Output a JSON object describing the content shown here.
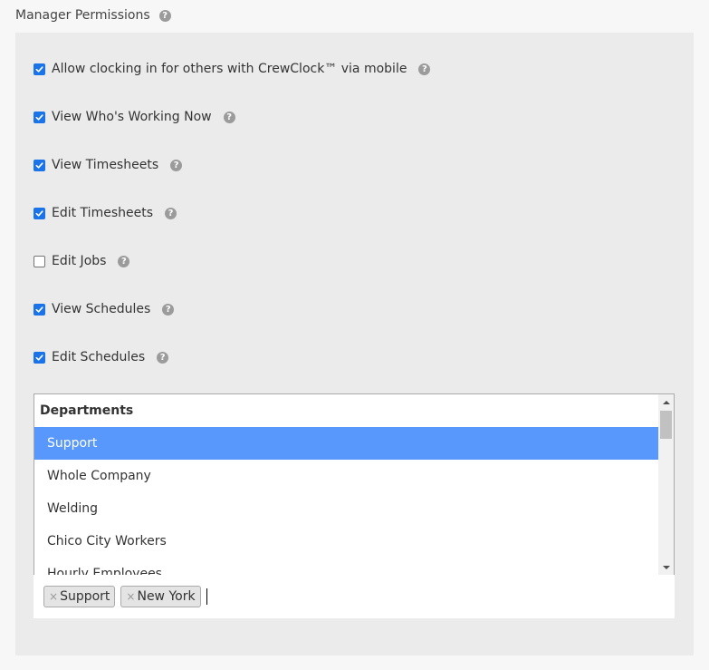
{
  "section": {
    "title": "Manager Permissions"
  },
  "permissions": [
    {
      "label": "Allow clocking in for others with CrewClock™ via mobile",
      "checked": true
    },
    {
      "label": "View Who's Working Now",
      "checked": true
    },
    {
      "label": "View Timesheets",
      "checked": true
    },
    {
      "label": "Edit Timesheets",
      "checked": true
    },
    {
      "label": "Edit Jobs",
      "checked": false
    },
    {
      "label": "View Schedules",
      "checked": true
    },
    {
      "label": "Edit Schedules",
      "checked": true
    }
  ],
  "departments": {
    "group_label": "Departments",
    "options": [
      {
        "label": "Support",
        "highlighted": true
      },
      {
        "label": "Whole Company",
        "highlighted": false
      },
      {
        "label": "Welding",
        "highlighted": false
      },
      {
        "label": "Chico City Workers",
        "highlighted": false
      },
      {
        "label": "Hourly Employees",
        "highlighted": false
      }
    ],
    "selected_tags": [
      {
        "label": "Support",
        "remove": "×"
      },
      {
        "label": "New York",
        "remove": "×"
      }
    ]
  },
  "icons": {
    "help": "question-circle-icon",
    "checkbox_checked": "check-icon",
    "tag_remove": "close-icon"
  },
  "colors": {
    "highlight": "#5897fb",
    "checkbox": "#1a73e8",
    "help_icon": "#9b9b9b"
  }
}
